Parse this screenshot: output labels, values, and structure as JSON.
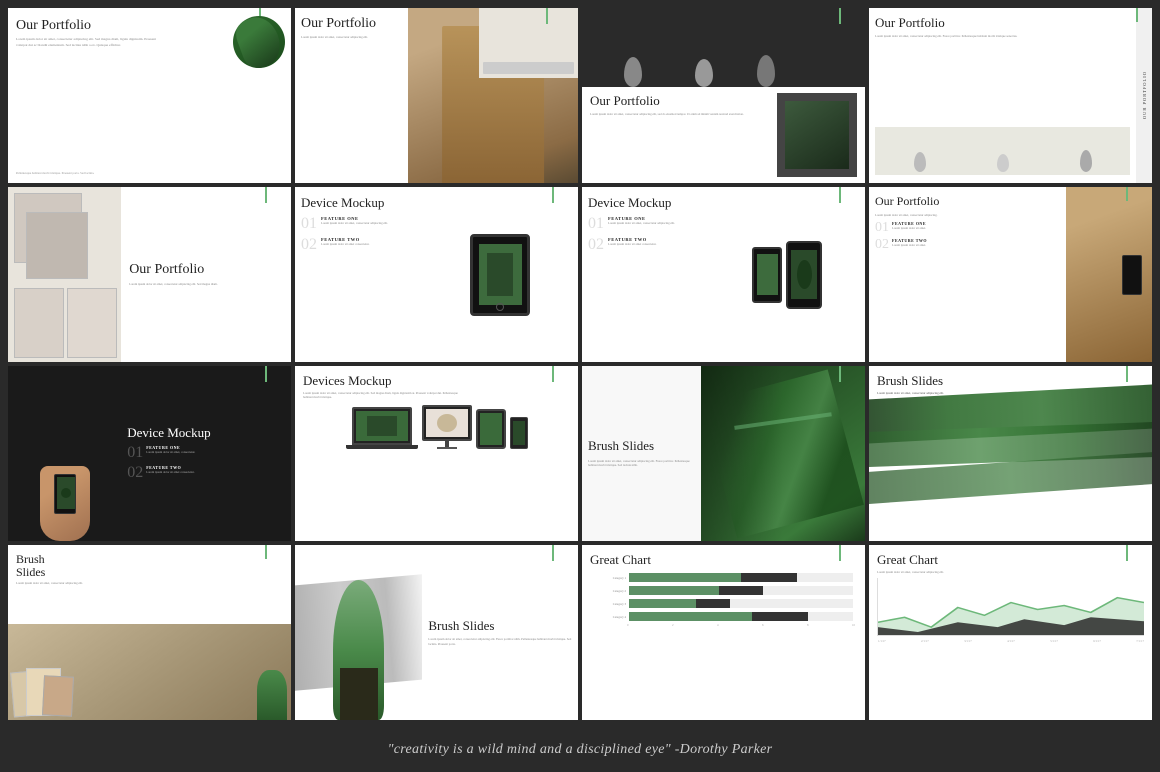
{
  "quote": "\"creativity is a wild mind and a disciplined eye\" -Dorothy Parker",
  "slides": [
    {
      "id": 1,
      "title": "Our Portfolio",
      "type": "portfolio-leaf"
    },
    {
      "id": 2,
      "title": "Our Portfolio",
      "type": "portfolio-woman"
    },
    {
      "id": 3,
      "title": "Our Portfolio",
      "type": "portfolio-dark"
    },
    {
      "id": 4,
      "title": "Our Portfolio",
      "type": "portfolio-lamps-vertical"
    },
    {
      "id": 5,
      "title": "Our Portfolio",
      "type": "portfolio-art"
    },
    {
      "id": 6,
      "title": "Device Mockup",
      "type": "device-tablet"
    },
    {
      "id": 7,
      "title": "Device Mockup",
      "type": "device-phones"
    },
    {
      "id": 8,
      "title": "Our Portfolio",
      "type": "portfolio-features"
    },
    {
      "id": 9,
      "title": "Device Mockup",
      "type": "device-dark-phone"
    },
    {
      "id": 10,
      "title": "Devices Mockup",
      "type": "devices-desktop"
    },
    {
      "id": 11,
      "title": "Brush Slides",
      "type": "brush-bird"
    },
    {
      "id": 12,
      "title": "Brush Slides",
      "type": "brush-green"
    },
    {
      "id": 13,
      "title": "Brush Slides",
      "type": "brush-dark"
    },
    {
      "id": 14,
      "title": "Brush Slides",
      "type": "brush-tree"
    },
    {
      "id": 15,
      "title": "Great Chart",
      "type": "chart-bar"
    },
    {
      "id": 16,
      "title": "Great Chart",
      "type": "chart-line"
    }
  ],
  "features": {
    "one": "FEATURE ONE",
    "two": "FEATURE TWO",
    "body": "Lorem ipsum dolor sit amet, consectetur adipiscing elit. Sed magna diam, ligula dignissim at. Ligula dignissim at magna."
  },
  "chart": {
    "categories": [
      "Category 1",
      "Category 2",
      "Category 3",
      "Category 4"
    ],
    "values_dark": [
      75,
      60,
      45,
      80
    ],
    "values_green": [
      50,
      40,
      30,
      55
    ]
  },
  "colors": {
    "green": "#6db87a",
    "dark": "#1a1a1a",
    "gray": "#2a2a2a",
    "white": "#ffffff",
    "light_gray": "#f5f5f5"
  }
}
